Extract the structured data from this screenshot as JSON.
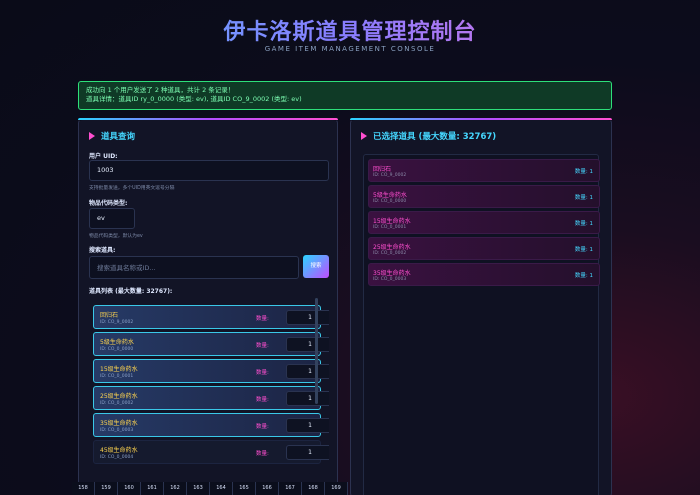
{
  "header": {
    "title": "伊卡洛斯道具管理控制台",
    "subtitle": "GAME ITEM MANAGEMENT CONSOLE"
  },
  "notice": {
    "line1": "成功向 1 个用户发送了 2 种道具，共计 2 条记录！",
    "line2": "道具详情：道具ID ry_0_0000 (类型: ev), 道具ID CO_9_0002 (类型: ev)"
  },
  "left": {
    "title": "道具查询",
    "uid_label": "用户 UID:",
    "uid_value": "1003",
    "uid_hint": "支持批量发送，多个UID用英文逗号分隔",
    "type_label": "物品代码类型:",
    "type_value": "ev",
    "type_hint": "物品代码类型，默认为ev",
    "search_label": "搜索道具:",
    "search_placeholder": "搜索道具名称或ID...",
    "search_button": "搜索",
    "list_label": "道具列表 (最大数量: 32767):",
    "qty_label": "数量:",
    "items": [
      {
        "name": "回归石",
        "id": "ID: CO_9_0002",
        "qty": "1"
      },
      {
        "name": "5级生命药水",
        "id": "ID: CO_0_0000",
        "qty": "1"
      },
      {
        "name": "15级生命药水",
        "id": "ID: CO_0_0001",
        "qty": "1"
      },
      {
        "name": "25级生命药水",
        "id": "ID: CO_0_0002",
        "qty": "1"
      },
      {
        "name": "35级生命药水",
        "id": "ID: CO_0_0003",
        "qty": "1"
      },
      {
        "name": "45级生命药水",
        "id": "ID: CO_0_0004",
        "qty": "1"
      }
    ]
  },
  "right": {
    "title": "已选择道具 (最大数量: 32767)",
    "qty_prefix": "数量: 1",
    "items": [
      {
        "name": "回归石",
        "id": "ID: CO_9_0002",
        "qty": "数量: 1"
      },
      {
        "name": "5级生命药水",
        "id": "ID: CO_0_0000",
        "qty": "数量: 1"
      },
      {
        "name": "15级生命药水",
        "id": "ID: CO_0_0001",
        "qty": "数量: 1"
      },
      {
        "name": "25级生命药水",
        "id": "ID: CO_0_0002",
        "qty": "数量: 1"
      },
      {
        "name": "35级生命药水",
        "id": "ID: CO_0_0003",
        "qty": "数量: 1"
      }
    ]
  },
  "pager": [
    "158",
    "159",
    "160",
    "161",
    "162",
    "163",
    "164",
    "165",
    "166",
    "167",
    "168",
    "169"
  ]
}
